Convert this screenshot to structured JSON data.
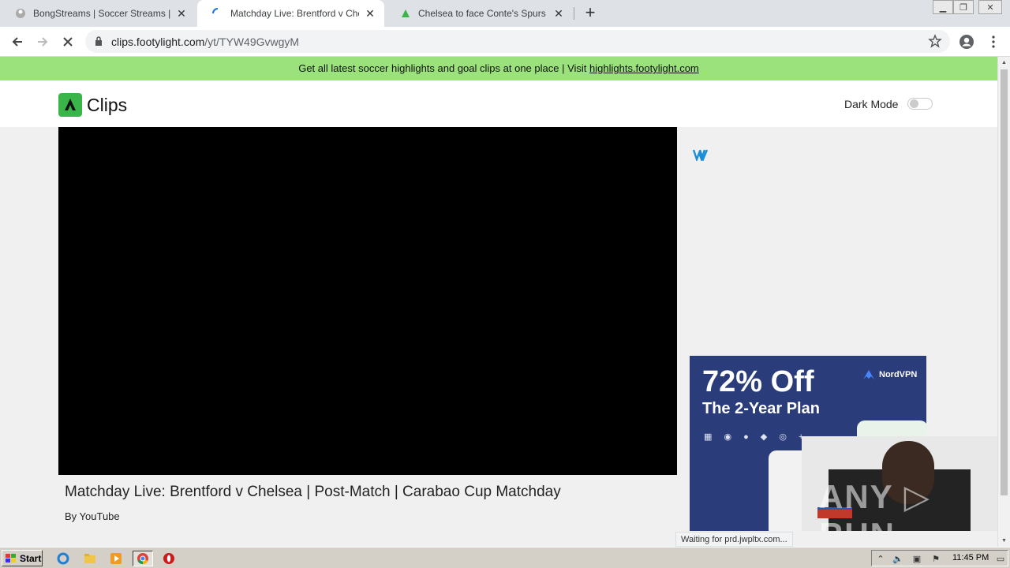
{
  "browser": {
    "tabs": [
      {
        "title": "BongStreams | Soccer Streams | NBA",
        "favicon": "bongstreams-favicon",
        "active": false
      },
      {
        "title": "Matchday Live: Brentford v Chelsea",
        "favicon": "loading-spinner-icon",
        "active": true
      },
      {
        "title": "Chelsea to face Conte's Spurs in EFL",
        "favicon": "footylight-favicon",
        "active": false
      }
    ],
    "new_tab_label": "+",
    "url_host": "clips.footylight.com",
    "url_path": "/yt/TYW49GvwgyM",
    "status_text": "Waiting for prd.jwpltx.com..."
  },
  "banner": {
    "text": "Get all latest soccer highlights and goal clips at one place | Visit ",
    "link_text": "highlights.footylight.com"
  },
  "site": {
    "logo_text": "Clips",
    "dark_mode_label": "Dark Mode",
    "dark_mode_on": false
  },
  "video": {
    "title": "Matchday Live: Brentford v Chelsea | Post-Match | Carabao Cup Matchday",
    "by": "By YouTube"
  },
  "ad": {
    "headline": "72% Off",
    "subline": "The 2-Year Plan",
    "brand": "NordVPN",
    "platforms": "▦ ◉ ● ◆ ◎ +"
  },
  "webcam": {
    "watermark": "ANY ▷ RUN"
  },
  "taskbar": {
    "start_label": "Start",
    "clock": "11:45 PM"
  },
  "colors": {
    "banner": "#9be27c",
    "logo_green": "#3ab54a",
    "ad_bg": "#2b3c7a"
  }
}
